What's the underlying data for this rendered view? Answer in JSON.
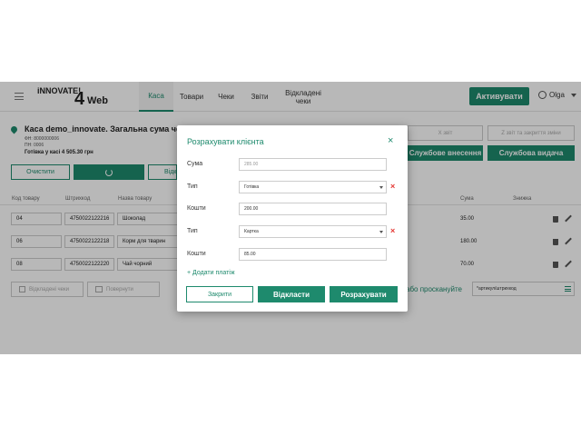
{
  "header": {
    "logo_text": "iNNOVATE!",
    "logo_num": "4",
    "logo_web": "Web",
    "tabs": [
      {
        "label": "Каса",
        "active": true
      },
      {
        "label": "Товари"
      },
      {
        "label": "Чеки"
      },
      {
        "label": "Звіти"
      },
      {
        "label": "Відкладені чеки"
      }
    ],
    "activate_label": "Активувати",
    "user_name": "Olga"
  },
  "cashier": {
    "title": "Каса demo_innovate. Загальна сума чек",
    "fn": "ФН: 8000000006",
    "pn": "ПН: 0006",
    "cash_total": "Готівка у касі 4 505.30 грн",
    "clear_label": "Очистити",
    "defer_label": "Відк",
    "x_report_label": "Х звіт",
    "z_report_label": "Z звіт та закриття зміни",
    "service_in_label": "Службове внесення",
    "service_out_label": "Службова видача"
  },
  "table": {
    "headers": [
      "Код товару",
      "Штрихкод",
      "Назва товару",
      "Сума",
      "Знижка"
    ],
    "rows": [
      {
        "code": "04",
        "barcode": "4750022122216",
        "name": "Шоколад",
        "sum": "35.00"
      },
      {
        "code": "06",
        "barcode": "4750022122218",
        "name": "Корм для тварин",
        "sum": "180.00"
      },
      {
        "code": "08",
        "barcode": "4750022122220",
        "name": "Чай чорний",
        "sum": "70.00"
      }
    ]
  },
  "footer": {
    "deferred_label": "Відкладені чеки",
    "return_label": "Повернути",
    "scan_hint": "або проскануйте",
    "article_placeholder": "*артикул/штрихкод"
  },
  "modal": {
    "title": "Розрахувати клієнта",
    "sum_label": "Сума",
    "sum_value": "285.00",
    "payments": [
      {
        "type_label": "Тип",
        "type_value": "Готівка",
        "amount_label": "Кошти",
        "amount_value": "200.00"
      },
      {
        "type_label": "Тип",
        "type_value": "Картка",
        "amount_label": "Кошти",
        "amount_value": "85.00"
      }
    ],
    "add_payment_label": "+ Додати платіж",
    "close_label": "Закрити",
    "defer_label": "Відкласти",
    "pay_label": "Розрахувати",
    "close_icon": "×",
    "remove_icon": "×"
  },
  "colors": {
    "accent": "#1e8a6d",
    "danger": "#e53935"
  }
}
